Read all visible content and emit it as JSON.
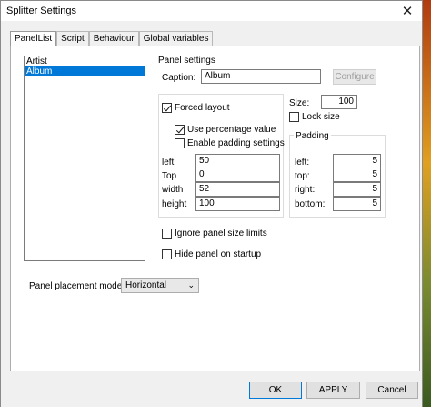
{
  "window": {
    "title": "Splitter Settings",
    "close_glyph": "✕"
  },
  "tabs": [
    {
      "label": "PanelList"
    },
    {
      "label": "Script"
    },
    {
      "label": "Behaviour"
    },
    {
      "label": "Global variables"
    }
  ],
  "panel_list": {
    "items": [
      "Artist",
      "Album"
    ],
    "selected": "Album"
  },
  "panel_settings": {
    "legend": "Panel settings",
    "caption_label": "Caption:",
    "caption_value": "Album",
    "configure_label": "Configure",
    "forced_layout_label": "Forced layout",
    "forced_layout_checked": true,
    "use_percentage_label": "Use percentage value",
    "use_percentage_checked": true,
    "enable_padding_label": "Enable padding settings",
    "enable_padding_checked": false,
    "left_label": "left",
    "left_value": "50",
    "top_label": "Top",
    "top_value": "0",
    "width_label": "width",
    "width_value": "52",
    "height_label": "height",
    "height_value": "100",
    "size_label": "Size:",
    "size_value": "100",
    "lock_size_label": "Lock size",
    "lock_size_checked": false,
    "padding_legend": "Padding",
    "pad_left_label": "left:",
    "pad_left_value": "5",
    "pad_top_label": "top:",
    "pad_top_value": "5",
    "pad_right_label": "right:",
    "pad_right_value": "5",
    "pad_bottom_label": "bottom:",
    "pad_bottom_value": "5",
    "ignore_limits_label": "Ignore panel size limits",
    "hide_on_startup_label": "Hide panel on startup"
  },
  "placement": {
    "label": "Panel placement mode:",
    "value": "Horizontal"
  },
  "footer": {
    "ok_label": "OK",
    "apply_label": "APPLY",
    "cancel_label": "Cancel"
  }
}
